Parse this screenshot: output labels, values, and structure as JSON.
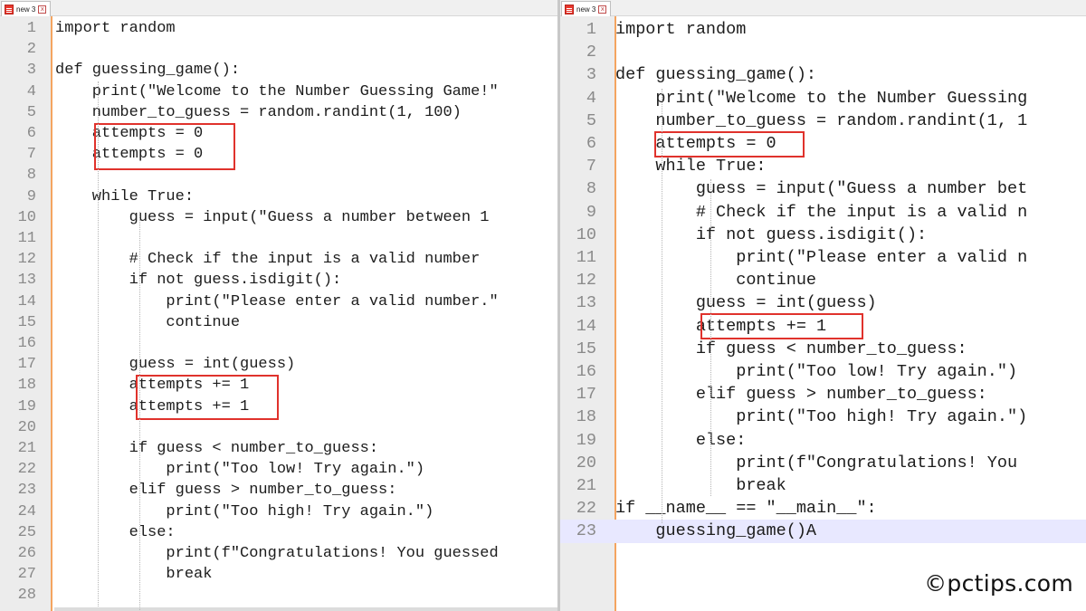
{
  "left_pane": {
    "tab": {
      "label": "new 3",
      "close": "x"
    },
    "lines": [
      {
        "n": "1",
        "code": "import random"
      },
      {
        "n": "2",
        "code": ""
      },
      {
        "n": "3",
        "code": "def guessing_game():"
      },
      {
        "n": "4",
        "code": "    print(\"Welcome to the Number Guessing Game!\""
      },
      {
        "n": "5",
        "code": "    number_to_guess = random.randint(1, 100)"
      },
      {
        "n": "6",
        "code": "    attempts = 0"
      },
      {
        "n": "7",
        "code": "    attempts = 0"
      },
      {
        "n": "8",
        "code": ""
      },
      {
        "n": "9",
        "code": "    while True:"
      },
      {
        "n": "10",
        "code": "        guess = input(\"Guess a number between 1"
      },
      {
        "n": "11",
        "code": ""
      },
      {
        "n": "12",
        "code": "        # Check if the input is a valid number"
      },
      {
        "n": "13",
        "code": "        if not guess.isdigit():"
      },
      {
        "n": "14",
        "code": "            print(\"Please enter a valid number.\""
      },
      {
        "n": "15",
        "code": "            continue"
      },
      {
        "n": "16",
        "code": ""
      },
      {
        "n": "17",
        "code": "        guess = int(guess)"
      },
      {
        "n": "18",
        "code": "        attempts += 1"
      },
      {
        "n": "19",
        "code": "        attempts += 1"
      },
      {
        "n": "20",
        "code": ""
      },
      {
        "n": "21",
        "code": "        if guess < number_to_guess:"
      },
      {
        "n": "22",
        "code": "            print(\"Too low! Try again.\")"
      },
      {
        "n": "23",
        "code": "        elif guess > number_to_guess:"
      },
      {
        "n": "24",
        "code": "            print(\"Too high! Try again.\")"
      },
      {
        "n": "25",
        "code": "        else:"
      },
      {
        "n": "26",
        "code": "            print(f\"Congratulations! You guessed"
      },
      {
        "n": "27",
        "code": "            break"
      },
      {
        "n": "28",
        "code": ""
      }
    ]
  },
  "right_pane": {
    "tab": {
      "label": "new 3",
      "close": "x"
    },
    "lines": [
      {
        "n": "1",
        "code": "import random"
      },
      {
        "n": "2",
        "code": ""
      },
      {
        "n": "3",
        "code": "def guessing_game():"
      },
      {
        "n": "4",
        "code": "    print(\"Welcome to the Number Guessing"
      },
      {
        "n": "5",
        "code": "    number_to_guess = random.randint(1, 1"
      },
      {
        "n": "6",
        "code": "    attempts = 0"
      },
      {
        "n": "7",
        "code": "    while True:"
      },
      {
        "n": "8",
        "code": "        guess = input(\"Guess a number bet"
      },
      {
        "n": "9",
        "code": "        # Check if the input is a valid n"
      },
      {
        "n": "10",
        "code": "        if not guess.isdigit():"
      },
      {
        "n": "11",
        "code": "            print(\"Please enter a valid n"
      },
      {
        "n": "12",
        "code": "            continue"
      },
      {
        "n": "13",
        "code": "        guess = int(guess)"
      },
      {
        "n": "14",
        "code": "        attempts += 1"
      },
      {
        "n": "15",
        "code": "        if guess < number_to_guess:"
      },
      {
        "n": "16",
        "code": "            print(\"Too low! Try again.\")"
      },
      {
        "n": "17",
        "code": "        elif guess > number_to_guess:"
      },
      {
        "n": "18",
        "code": "            print(\"Too high! Try again.\")"
      },
      {
        "n": "19",
        "code": "        else:"
      },
      {
        "n": "20",
        "code": "            print(f\"Congratulations! You"
      },
      {
        "n": "21",
        "code": "            break"
      },
      {
        "n": "22",
        "code": "if __name__ == \"__main__\":"
      },
      {
        "n": "23",
        "code": "    guessing_game()A"
      }
    ]
  },
  "watermark": "©pctips.com",
  "colors": {
    "highlight_box": "#e0322c",
    "gutter": "#ececec",
    "gutter_border": "#f4a460",
    "current_line": "#e8e8ff"
  }
}
